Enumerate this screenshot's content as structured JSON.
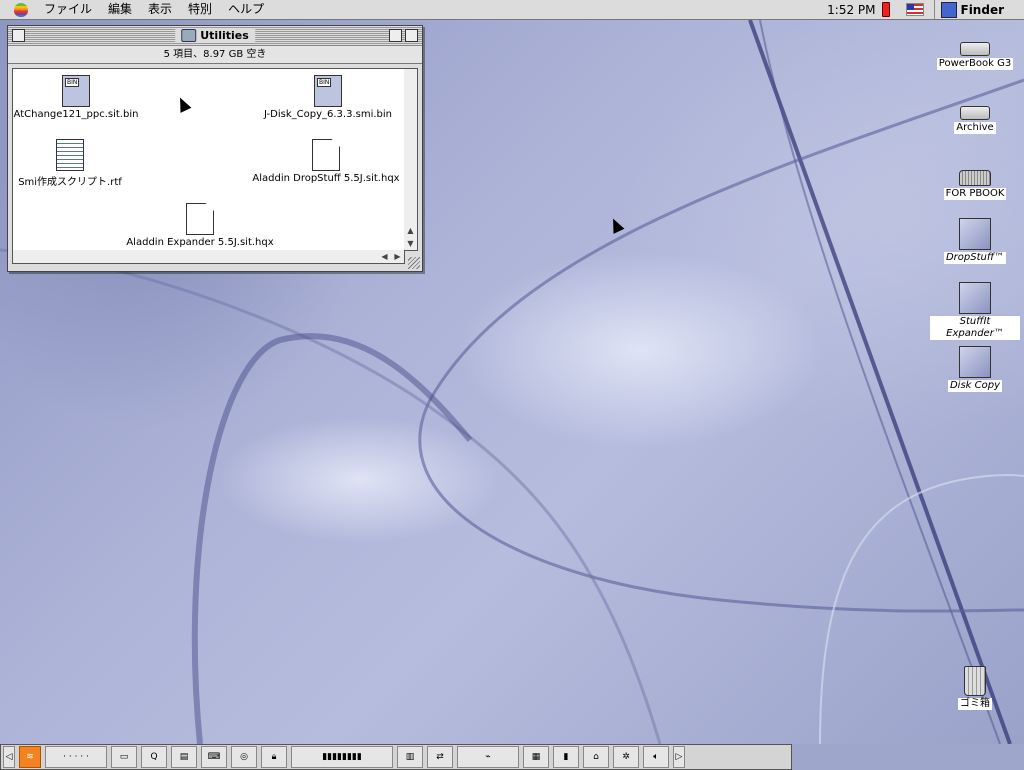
{
  "menubar": {
    "items": [
      "ファイル",
      "編集",
      "表示",
      "特別",
      "ヘルプ"
    ],
    "clock": "1:52 PM",
    "app_name": "Finder",
    "apple_icon": "apple-logo-icon",
    "colors": {
      "bar": "#dcdcdc"
    }
  },
  "window": {
    "title": "Utilities",
    "status": "5 項目、8.97 GB 空き",
    "files": [
      {
        "name": "AtChange121_ppc.sit.bin",
        "icon": "bin-file-icon"
      },
      {
        "name": "J-Disk_Copy_6.3.3.smi.bin",
        "icon": "bin-file-icon"
      },
      {
        "name": "Smi作成スクリプト.rtf",
        "icon": "rtf-document-icon"
      },
      {
        "name": "Aladdin DropStuff 5.5J.sit.hqx",
        "icon": "document-icon"
      },
      {
        "name": "Aladdin Expander 5.5J.sit.hqx",
        "icon": "document-icon"
      }
    ]
  },
  "desktop": {
    "icons": [
      {
        "name": "PowerBook G3",
        "icon": "hard-disk-icon"
      },
      {
        "name": "Archive",
        "icon": "hard-disk-icon"
      },
      {
        "name": "FOR PBOOK",
        "icon": "shared-disk-icon"
      },
      {
        "name": "DropStuff™",
        "icon": "dropstuff-app-icon"
      },
      {
        "name": "StuffIt Expander™",
        "icon": "stuffit-expander-app-icon"
      },
      {
        "name": "Disk Copy",
        "icon": "disk-copy-app-icon"
      },
      {
        "name": "ゴミ箱",
        "icon": "trash-icon"
      }
    ]
  },
  "control_strip": {
    "modules": [
      "rss-icon",
      "monitor-icon",
      "quicktime-icon",
      "printer-icon",
      "keyboard-icon",
      "cd-icon",
      "lock-icon",
      "brightness-icon",
      "battery-icon",
      "print-icon",
      "file-sharing-icon",
      "appletalk-icon",
      "monitor-depth-icon",
      "monitor-resolution-icon",
      "location-icon",
      "remote-access-icon",
      "speaker-icon"
    ]
  }
}
